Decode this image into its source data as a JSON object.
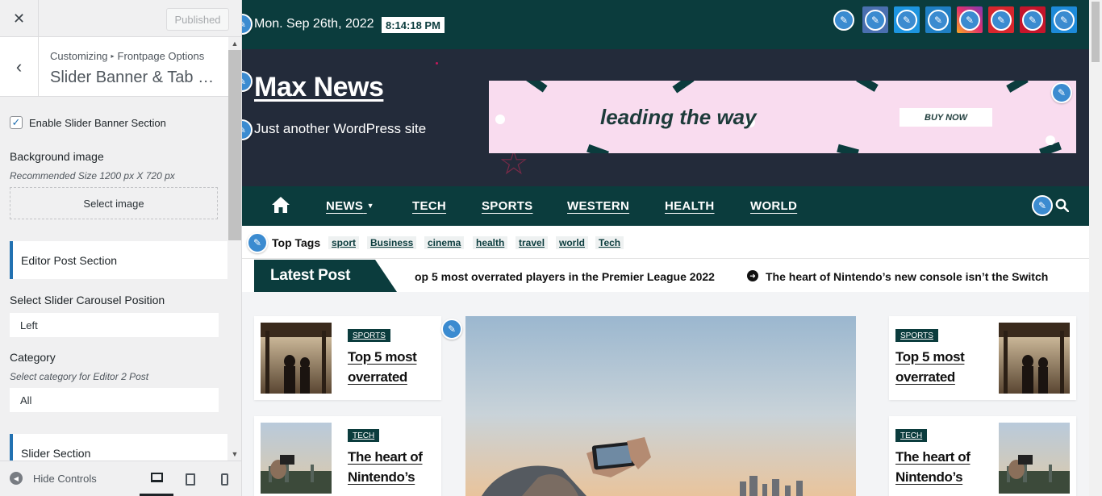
{
  "customizer": {
    "close_label": "✕",
    "published_label": "Published",
    "back_label": "‹",
    "breadcrumb_root": "Customizing",
    "breadcrumb_separator": "▸",
    "breadcrumb_parent": "Frontpage Options",
    "section_title": "Slider Banner & Tab Section",
    "enable_label": "Enable Slider Banner Section",
    "enable_checked": true,
    "bg_image_label": "Background image",
    "bg_image_desc": "Recommended Size 1200 px X 720 px",
    "select_image_label": "Select image",
    "editor_post_heading": "Editor Post Section",
    "carousel_position_label": "Select Slider Carousel Position",
    "carousel_position_value": "Left",
    "category_label": "Category",
    "category_desc": "Select category for Editor 2 Post",
    "category_value": "All",
    "slider_heading": "Slider Section",
    "hide_controls_label": "Hide Controls",
    "devices": [
      "desktop",
      "tablet",
      "mobile"
    ],
    "active_device": "desktop"
  },
  "site": {
    "date": "Mon. Sep 26th, 2022",
    "time": "8:14:18 PM",
    "social": [
      {
        "name": "edit",
        "color": "#3b8bd0"
      },
      {
        "name": "edit",
        "color": "#4a6fb0"
      },
      {
        "name": "edit",
        "color": "#1d95e0"
      },
      {
        "name": "edit",
        "color": "#1f7fc4"
      },
      {
        "name": "instagram",
        "color": "#d6249f"
      },
      {
        "name": "edit",
        "color": "#d6262d"
      },
      {
        "name": "edit",
        "color": "#c4152b"
      },
      {
        "name": "edit",
        "color": "#1d8ad8"
      }
    ],
    "title": "Max News",
    "tagline": "Just another WordPress site",
    "banner_text": "leading the way",
    "banner_button": "BUY NOW",
    "nav": [
      "NEWS",
      "TECH",
      "SPORTS",
      "WESTERN",
      "HEALTH",
      "WORLD"
    ],
    "top_tags_label": "Top Tags",
    "tags": [
      "sport",
      "Business",
      "cinema",
      "health",
      "travel",
      "world",
      "Tech"
    ],
    "latest_label": "Latest Post",
    "ticker_1": "op 5 most overrated players in the Premier League 2022",
    "ticker_2": "The heart of Nintendo’s new console isn’t the Switch",
    "left_cards": [
      {
        "category": "SPORTS",
        "title": "Top 5 most overrated"
      },
      {
        "category": "TECH",
        "title": "The heart of Nintendo’s"
      }
    ],
    "right_cards": [
      {
        "category": "SPORTS",
        "title": "Top 5 most overrated"
      },
      {
        "category": "TECH",
        "title": "The heart of Nintendo’s"
      }
    ],
    "colors": {
      "brand_dark": "#0b3c3d",
      "header_bg": "#232b3a",
      "banner_bg": "#f9dcef",
      "edit_blue": "#3b8bd0"
    }
  }
}
